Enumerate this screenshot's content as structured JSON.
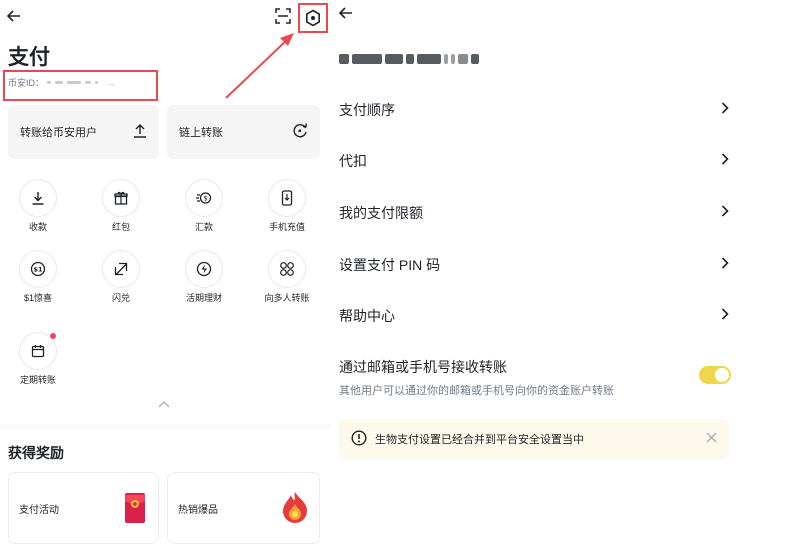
{
  "left": {
    "title": "支付",
    "binance_id_label": "币安ID：",
    "cards": [
      {
        "label": "转账给币安用户",
        "icon": "upload-icon"
      },
      {
        "label": "链上转账",
        "icon": "chain-transfer-icon"
      }
    ],
    "grid": [
      {
        "label": "收款",
        "icon": "download-icon"
      },
      {
        "label": "红包",
        "icon": "gift-icon"
      },
      {
        "label": "汇款",
        "icon": "remittance-icon"
      },
      {
        "label": "手机充值",
        "icon": "phone-topup-icon"
      },
      {
        "label": "$1惊喜",
        "icon": "dollar-coin-icon"
      },
      {
        "label": "闪兑",
        "icon": "swap-icon"
      },
      {
        "label": "活期理财",
        "icon": "savings-icon"
      },
      {
        "label": "向多人转账",
        "icon": "multi-transfer-icon"
      },
      {
        "label": "定期转账",
        "icon": "calendar-icon"
      }
    ],
    "rewards_title": "获得奖励",
    "rewards": [
      {
        "label": "支付活动",
        "icon": "red-envelope-icon"
      },
      {
        "label": "热销爆品",
        "icon": "fire-icon"
      }
    ]
  },
  "right": {
    "menu": [
      {
        "label": "支付顺序"
      },
      {
        "label": "代扣"
      },
      {
        "label": "我的支付限额"
      },
      {
        "label": "设置支付 PIN 码"
      },
      {
        "label": "帮助中心"
      }
    ],
    "toggle": {
      "title": "通过邮箱或手机号接收转账",
      "subtitle": "其他用户可以通过你的邮箱或手机号向你的资金账户转账",
      "state": "on"
    },
    "notice": {
      "text": "生物支付设置已经合并到平台安全设置当中"
    }
  },
  "colors": {
    "accent_yellow": "#f0d64a",
    "highlight_red": "#e84a4f",
    "notice_bg": "#fdfaeb"
  }
}
